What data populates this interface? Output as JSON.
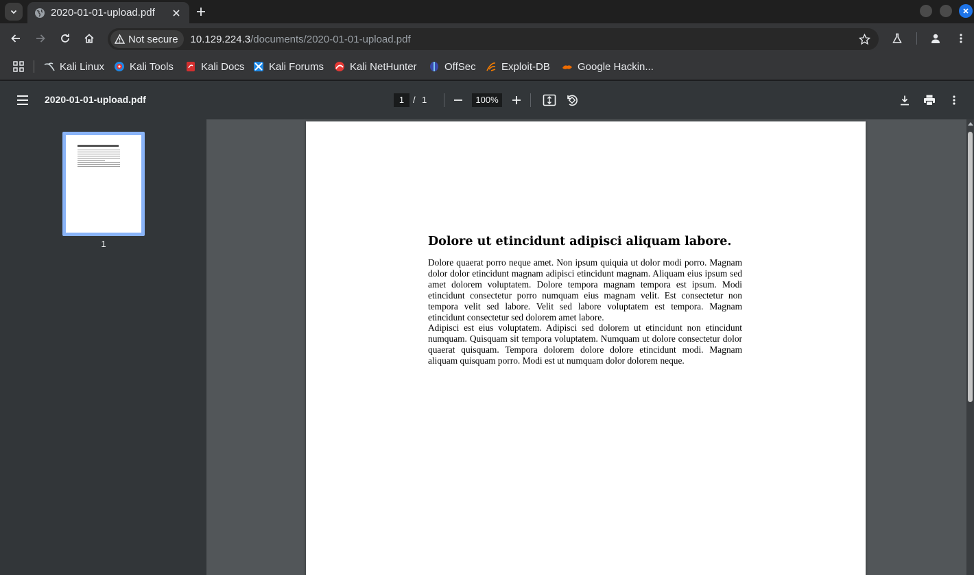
{
  "browser": {
    "tab": {
      "title": "2020-01-01-upload.pdf"
    },
    "address": {
      "security_label": "Not secure",
      "url_host": "10.129.224.3",
      "url_path": "/documents/2020-01-01-upload.pdf"
    },
    "bookmarks": [
      {
        "label": "Kali Linux",
        "icon": "kali-linux-icon",
        "color": "#cfd8dc"
      },
      {
        "label": "Kali Tools",
        "icon": "kali-tools-icon",
        "color": "#e53935"
      },
      {
        "label": "Kali Docs",
        "icon": "kali-docs-icon",
        "color": "#d32f2f"
      },
      {
        "label": "Kali Forums",
        "icon": "kali-forums-icon",
        "color": "#1e88e5"
      },
      {
        "label": "Kali NetHunter",
        "icon": "kali-nethunter-icon",
        "color": "#e53935"
      },
      {
        "label": "OffSec",
        "icon": "offsec-icon",
        "color": "#5c6bc0"
      },
      {
        "label": "Exploit-DB",
        "icon": "exploit-db-icon",
        "color": "#f57c00"
      },
      {
        "label": "Google Hackin...",
        "icon": "google-hacking-icon",
        "color": "#ef6c00"
      }
    ]
  },
  "pdf_viewer": {
    "title": "2020-01-01-upload.pdf",
    "current_page": "1",
    "page_separator": "/",
    "total_pages": "1",
    "zoom": "100%",
    "thumbnail_label": "1"
  },
  "document": {
    "heading": "Dolore ut etincidunt adipisci aliquam labore.",
    "paragraphs": [
      "Dolore quaerat porro neque amet. Non ipsum quiquia ut dolor modi porro. Magnam dolor dolor etincidunt magnam adipisci etincidunt magnam. Aliquam eius ipsum sed amet dolorem voluptatem. Dolore tempora magnam tempora est ipsum. Modi etincidunt consectetur porro numquam eius magnam velit. Est consectetur non tempora velit sed labore. Velit sed labore voluptatem est tempora. Magnam etincidunt consectetur sed dolorem amet labore.",
      "Adipisci est eius voluptatem. Adipisci sed dolorem ut etincidunt non etincidunt numquam. Quisquam sit tempora voluptatem. Numquam ut dolore consectetur dolor quaerat quisquam. Tempora dolorem dolore dolore etincidunt modi. Magnam aliquam quisquam porro. Modi est ut numquam dolor dolorem neque."
    ]
  }
}
